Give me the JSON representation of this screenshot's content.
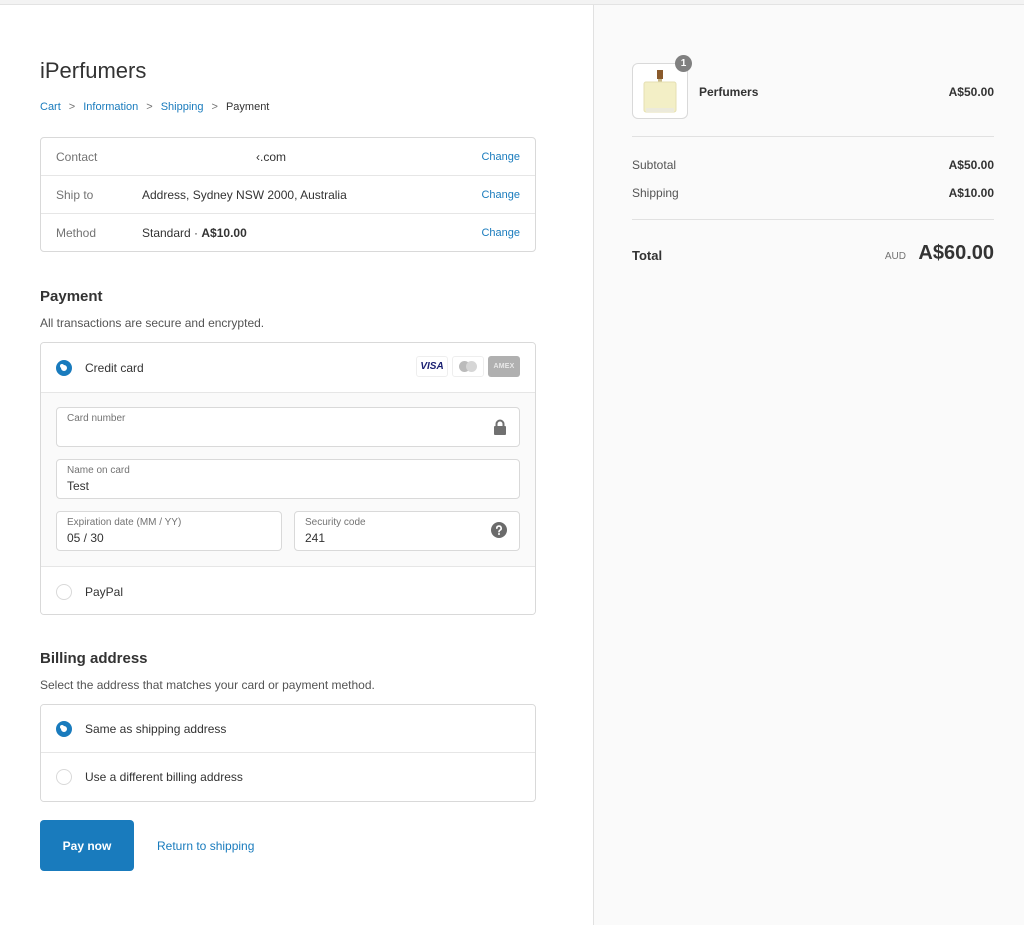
{
  "store": {
    "title": "iPerfumers"
  },
  "breadcrumb": [
    {
      "label": "Cart",
      "link": true
    },
    {
      "label": "Information",
      "link": true
    },
    {
      "label": "Shipping",
      "link": true
    },
    {
      "label": "Payment",
      "link": false
    }
  ],
  "breadcrumb_separator": ">",
  "review": {
    "contact": {
      "label": "Contact",
      "value": "‹.com",
      "action": "Change"
    },
    "ship_to": {
      "label": "Ship to",
      "value": "Address, Sydney NSW 2000, Australia",
      "action": "Change"
    },
    "method": {
      "label": "Method",
      "value_prefix": "Standard · ",
      "value_price": "A$10.00",
      "action": "Change"
    }
  },
  "payment": {
    "title": "Payment",
    "subtitle": "All transactions are secure and encrypted.",
    "options": {
      "credit_card": {
        "label": "Credit card",
        "selected": true
      },
      "paypal": {
        "label": "PayPal",
        "selected": false
      }
    },
    "card_brands": {
      "visa": "VISA",
      "amex": "AMEX"
    },
    "fields": {
      "card_number": {
        "label": "Card number",
        "value": ""
      },
      "name_on_card": {
        "label": "Name on card",
        "value": "Test"
      },
      "expiration": {
        "label": "Expiration date (MM / YY)",
        "value": "05 / 30"
      },
      "security_code": {
        "label": "Security code",
        "value": "241"
      }
    }
  },
  "billing": {
    "title": "Billing address",
    "subtitle": "Select the address that matches your card or payment method.",
    "options": {
      "same": {
        "label": "Same as shipping address",
        "selected": true
      },
      "different": {
        "label": "Use a different billing address",
        "selected": false
      }
    }
  },
  "actions": {
    "pay_now": "Pay now",
    "return": "Return to shipping"
  },
  "summary": {
    "item": {
      "name": "Perfumers",
      "price": "A$50.00",
      "quantity": "1"
    },
    "subtotal": {
      "label": "Subtotal",
      "value": "A$50.00"
    },
    "shipping": {
      "label": "Shipping",
      "value": "A$10.00"
    },
    "total": {
      "label": "Total",
      "currency": "AUD",
      "value": "A$60.00"
    }
  },
  "colors": {
    "accent": "#197bbd",
    "sidebar_bg": "#fafafa"
  }
}
